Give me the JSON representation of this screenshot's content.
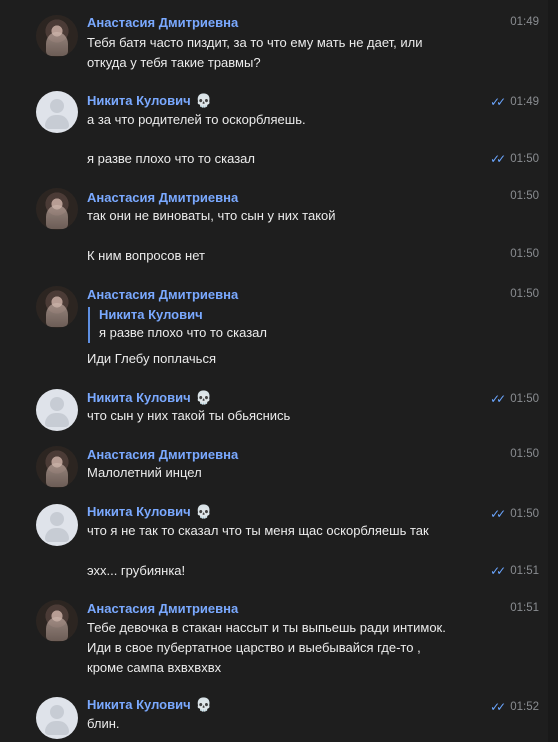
{
  "messages": [
    {
      "author": "Анастасия Дмитриевна",
      "author_type": "anastasia",
      "groups": [
        {
          "lines": [
            "Тебя батя часто пиздит, за то что ему мать не дает, или",
            "откуда у тебя такие травмы?"
          ],
          "time": "01:49",
          "read": false
        }
      ]
    },
    {
      "author": "Никита Кулович",
      "author_type": "nikita",
      "groups": [
        {
          "lines": [
            "а за что родителей то оскорбляешь."
          ],
          "time": "01:49",
          "read": true
        },
        {
          "lines": [
            "я разве плохо что то сказал"
          ],
          "time": "01:50",
          "read": true
        }
      ]
    },
    {
      "author": "Анастасия Дмитриевна",
      "author_type": "anastasia",
      "groups": [
        {
          "lines": [
            "так они не виноваты, что сын у них такой"
          ],
          "time": "01:50",
          "read": false
        },
        {
          "lines": [
            "К ним вопросов нет"
          ],
          "time": "01:50",
          "read": false
        }
      ]
    },
    {
      "author": "Анастасия Дмитриевна",
      "author_type": "anastasia",
      "groups": [
        {
          "quote_author": "Никита Кулович",
          "quote_text": "я разве плохо что то сказал",
          "lines": [
            "Иди Глебу поплачься"
          ],
          "time": "01:50",
          "read": false
        }
      ]
    },
    {
      "author": "Никита Кулович",
      "author_type": "nikita",
      "groups": [
        {
          "lines": [
            "что сын у них такой ты обьяснись"
          ],
          "time": "01:50",
          "read": true
        }
      ]
    },
    {
      "author": "Анастасия Дмитриевна",
      "author_type": "anastasia",
      "groups": [
        {
          "lines": [
            "Малолетний инцел"
          ],
          "time": "01:50",
          "read": false
        }
      ]
    },
    {
      "author": "Никита Кулович",
      "author_type": "nikita",
      "groups": [
        {
          "lines": [
            "что я не так то сказал что ты меня щас оскорбляешь так"
          ],
          "time": "01:50",
          "read": true
        },
        {
          "lines": [
            "эхх... грубиянка!"
          ],
          "time": "01:51",
          "read": true
        }
      ]
    },
    {
      "author": "Анастасия Дмитриевна",
      "author_type": "anastasia",
      "groups": [
        {
          "lines": [
            "Тебе девочка в стакан нассыт и ты выпьешь ради интимок.",
            "Иди в свое пубертатное царство и выебывайся где-то ,",
            "кроме сампа вхвхвхвх"
          ],
          "time": "01:51",
          "read": false
        }
      ]
    },
    {
      "author": "Никита Кулович",
      "author_type": "nikita",
      "groups": [
        {
          "lines": [
            "блин."
          ],
          "time": "01:52",
          "read": true
        }
      ]
    }
  ],
  "skull_emoji": "💀",
  "read_icon": "double-check-icon"
}
